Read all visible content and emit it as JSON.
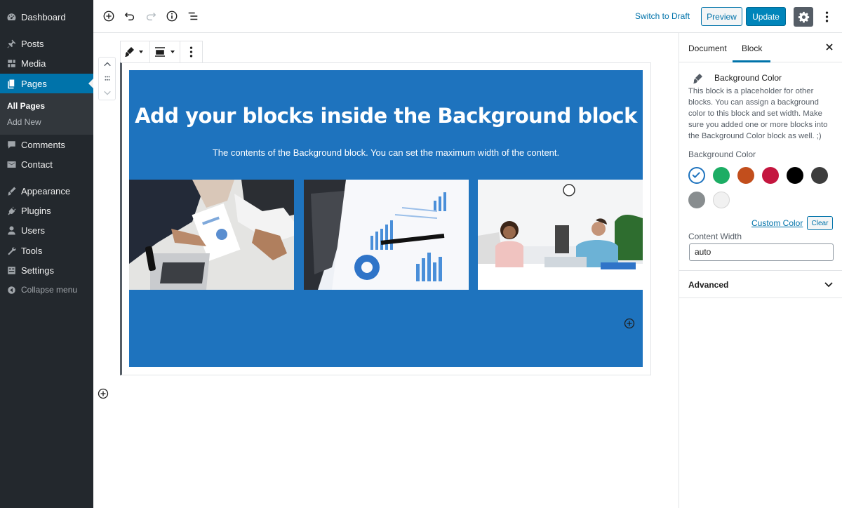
{
  "admin_menu": {
    "items": [
      {
        "label": "Dashboard",
        "icon": "dashboard-icon"
      },
      {
        "label": "Posts",
        "icon": "pin-icon"
      },
      {
        "label": "Media",
        "icon": "media-icon"
      },
      {
        "label": "Pages",
        "icon": "pages-icon"
      },
      {
        "label": "Comments",
        "icon": "comments-icon"
      },
      {
        "label": "Contact",
        "icon": "mail-icon"
      },
      {
        "label": "Appearance",
        "icon": "brush-icon"
      },
      {
        "label": "Plugins",
        "icon": "plugin-icon"
      },
      {
        "label": "Users",
        "icon": "users-icon"
      },
      {
        "label": "Tools",
        "icon": "wrench-icon"
      },
      {
        "label": "Settings",
        "icon": "settings-icon"
      }
    ],
    "submenu": {
      "all_pages": "All Pages",
      "add_new": "Add New"
    },
    "collapse": "Collapse menu",
    "active": "Pages"
  },
  "toolbar": {
    "switch_to_draft": "Switch to Draft",
    "preview": "Preview",
    "update": "Update"
  },
  "editor": {
    "heading": "Add your blocks inside the Background block",
    "paragraph": "The contents of the Background block. You can set the maximum width of the content.",
    "background_color": "#1e73be"
  },
  "sidebar": {
    "tabs": {
      "document": "Document",
      "block": "Block"
    },
    "block_title": "Background Color",
    "block_description": "This block is a placeholder for other blocks. You can assign a background color to this block and set width. Make sure you added one or more blocks into the Background Color block as well. ;)",
    "background_color_label": "Background Color",
    "swatches": [
      "#1e73be",
      "#1cad64",
      "#c24e1c",
      "#c4163f",
      "#000000",
      "#3d3d3d",
      "#888d8f",
      "#f1f1f1"
    ],
    "selected_swatch": "#1e73be",
    "custom_color": "Custom Color",
    "clear": "Clear",
    "content_width_label": "Content Width",
    "content_width_value": "auto",
    "advanced": "Advanced"
  },
  "colors": {
    "accent": "#0073aa",
    "admin_bg": "#23282d"
  }
}
